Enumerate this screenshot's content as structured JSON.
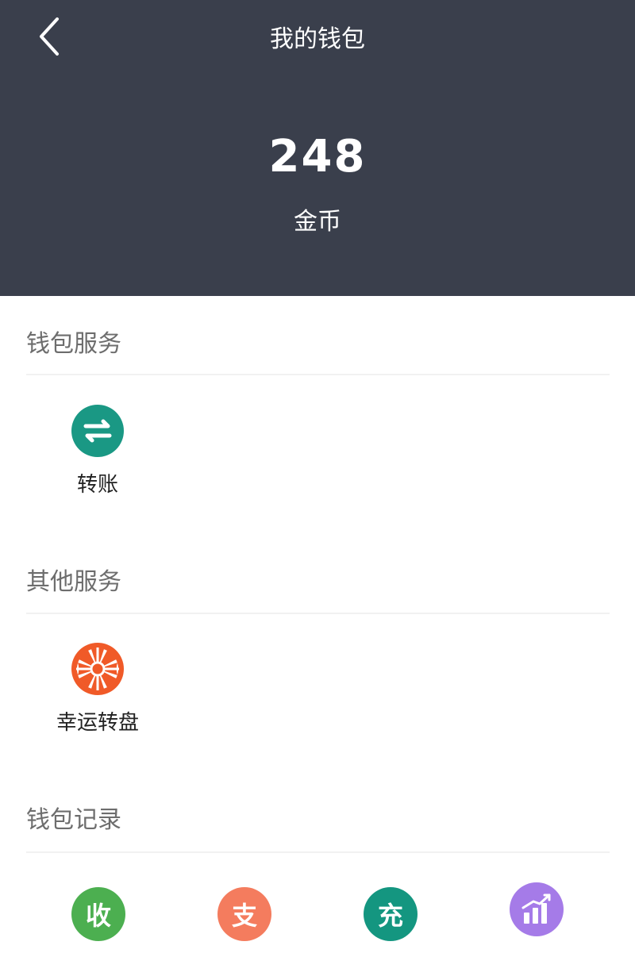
{
  "header": {
    "title": "我的钱包",
    "balance": "248",
    "unit": "金币",
    "background_color": "#3a3f4c"
  },
  "wallet_services": {
    "title": "钱包服务",
    "items": [
      {
        "label": "转账",
        "icon": "transfer-arrows-icon",
        "color": "#1a9884"
      }
    ]
  },
  "other_services": {
    "title": "其他服务",
    "items": [
      {
        "label": "幸运转盘",
        "icon": "lucky-wheel-icon",
        "color": "#f05a28"
      }
    ]
  },
  "wallet_records": {
    "title": "钱包记录",
    "items": [
      {
        "glyph": "收",
        "icon": "income-icon",
        "color": "#4caf50"
      },
      {
        "glyph": "支",
        "icon": "expense-icon",
        "color": "#f47c5e"
      },
      {
        "glyph": "充",
        "icon": "recharge-icon",
        "color": "#149680"
      },
      {
        "glyph": "",
        "icon": "statistics-chart-icon",
        "color": "#a57be8"
      }
    ]
  }
}
